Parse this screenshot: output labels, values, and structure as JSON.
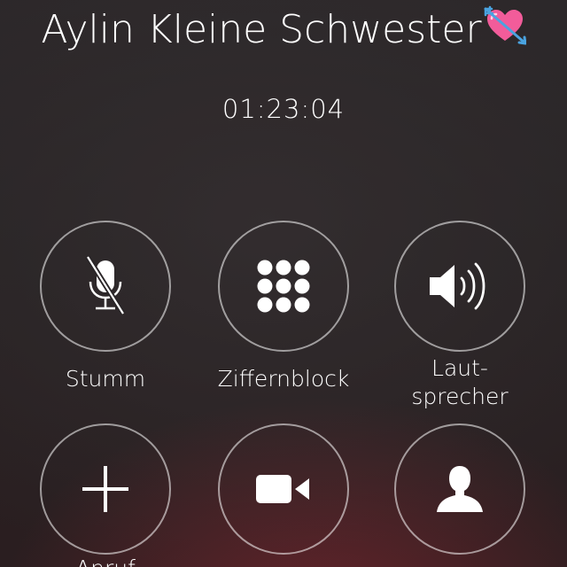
{
  "call": {
    "caller_name": "Aylin Kleine Schwester",
    "caller_emoji": "heart-with-arrow-emoji",
    "duration": "01:23:04"
  },
  "controls": [
    {
      "id": "mute",
      "label": "Stumm",
      "icon": "microphone-muted-icon"
    },
    {
      "id": "keypad",
      "label": "Ziffernblock",
      "icon": "keypad-icon"
    },
    {
      "id": "speaker",
      "label_line1": "Laut-",
      "label_line2": "sprecher",
      "icon": "speaker-icon"
    },
    {
      "id": "add-call",
      "label": "Anruf",
      "icon": "plus-icon"
    },
    {
      "id": "facetime",
      "icon": "video-camera-icon"
    },
    {
      "id": "contacts",
      "icon": "contact-silhouette-icon"
    }
  ],
  "colors": {
    "text": "#ffffff",
    "ring": "#ffffff",
    "accent_glow": "#96283a"
  }
}
